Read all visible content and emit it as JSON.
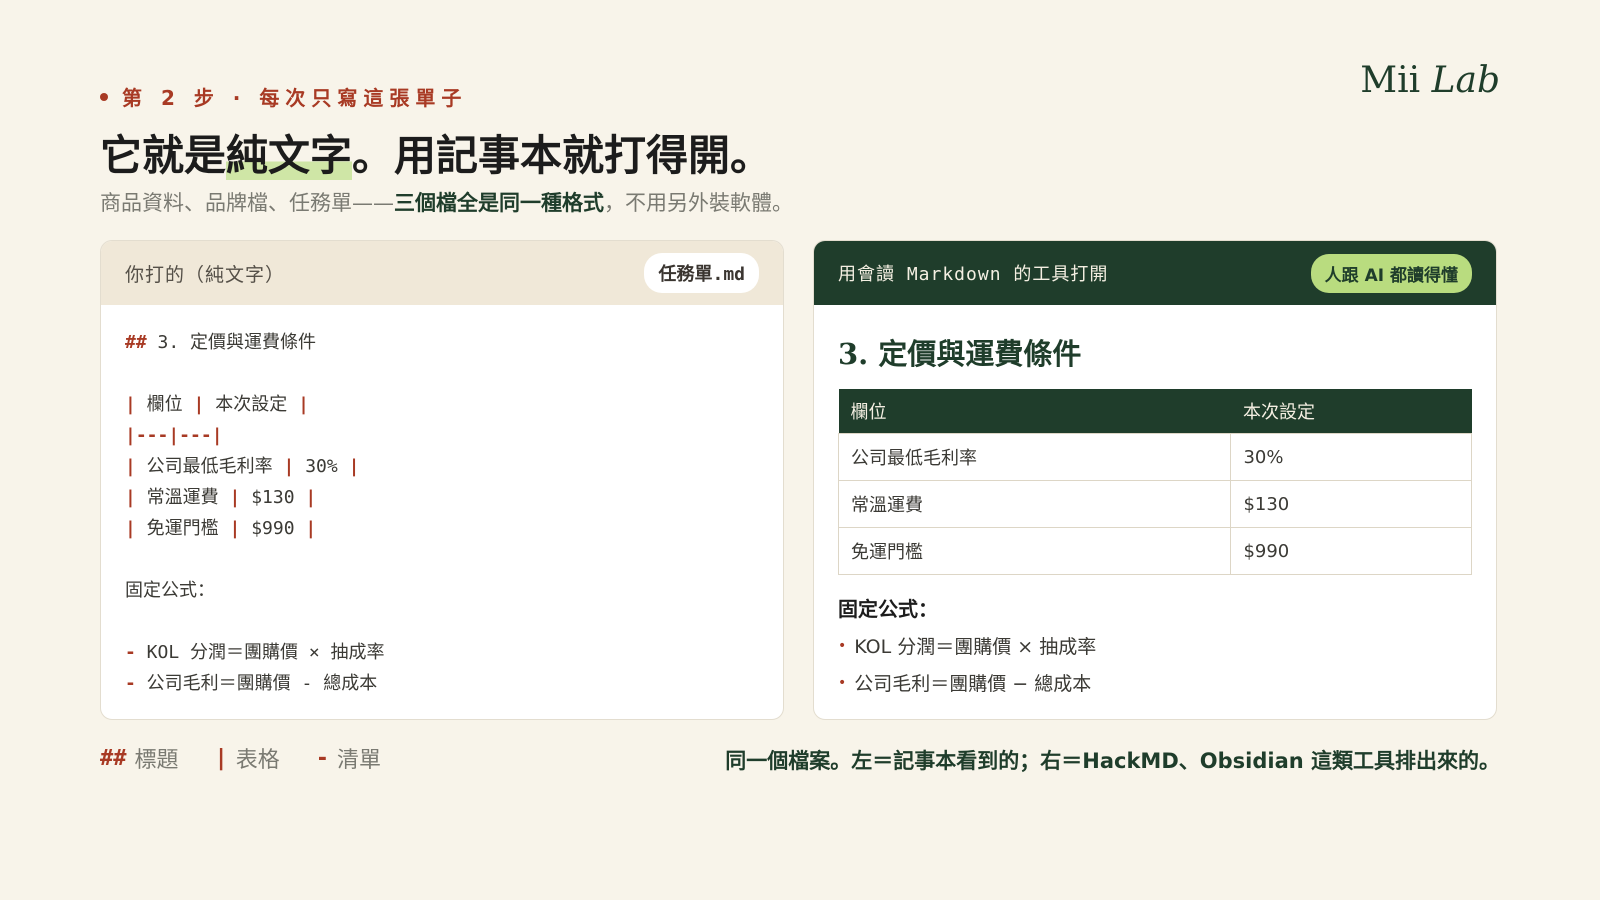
{
  "brand": {
    "mii": "Mii",
    "lab": "Lab"
  },
  "step_label": "第 2 步 · 每次只寫這張單子",
  "title": {
    "before": "它就是",
    "highlight": "純文字",
    "after": "。用記事本就打得開。"
  },
  "subtitle": {
    "before": "商品資料、品牌檔、任務單——",
    "emphasis": "三個檔全是同一種格式",
    "after": "，不用另外裝軟體。"
  },
  "left_panel": {
    "header": "你打的（純文字）",
    "chip": "任務單.md",
    "lines": [
      {
        "m1": "##",
        "t": " 3. 定價與運費條件"
      },
      {
        "gap": true
      },
      {
        "m1": "|",
        "t": " 欄位 ",
        "m2": "|",
        "t2": " 本次設定 ",
        "m3": "|"
      },
      {
        "m1": "|---|---|"
      },
      {
        "m1": "|",
        "t": " 公司最低毛利率 ",
        "m2": "|",
        "t2": " 30% ",
        "m3": "|"
      },
      {
        "m1": "|",
        "t": " 常溫運費 ",
        "m2": "|",
        "t2": " $130 ",
        "m3": "|"
      },
      {
        "m1": "|",
        "t": " 免運門檻 ",
        "m2": "|",
        "t2": " $990 ",
        "m3": "|"
      },
      {
        "gap": true
      },
      {
        "t": "固定公式："
      },
      {
        "gap": true
      },
      {
        "m1": "-",
        "t": " KOL 分潤＝團購價 × 抽成率"
      },
      {
        "m1": "-",
        "t": " 公司毛利＝團購價 - 總成本"
      }
    ]
  },
  "right_panel": {
    "header": "用會讀 Markdown 的工具打開",
    "chip": "人跟 AI 都讀得懂",
    "heading": "3. 定價與運費條件",
    "table": {
      "headers": [
        "欄位",
        "本次設定"
      ],
      "rows": [
        [
          "公司最低毛利率",
          "30%"
        ],
        [
          "常溫運費",
          "$130"
        ],
        [
          "免運門檻",
          "$990"
        ]
      ]
    },
    "label": "固定公式：",
    "list": [
      "KOL 分潤＝團購價 × 抽成率",
      "公司毛利＝團購價 − 總成本"
    ]
  },
  "legend": [
    {
      "sym": "##",
      "label": "標題"
    },
    {
      "sym": "|",
      "label": "表格"
    },
    {
      "sym": "-",
      "label": "清單"
    }
  ],
  "footnote": "同一個檔案。左＝記事本看到的；右＝HackMD、Obsidian 這類工具排出來的。",
  "colors": {
    "accent": "#a83a24",
    "primary": "#1f3d2b",
    "highlight": "#cfe6a6",
    "chip_green": "#b9dc7f",
    "background": "#f8f4ea"
  }
}
